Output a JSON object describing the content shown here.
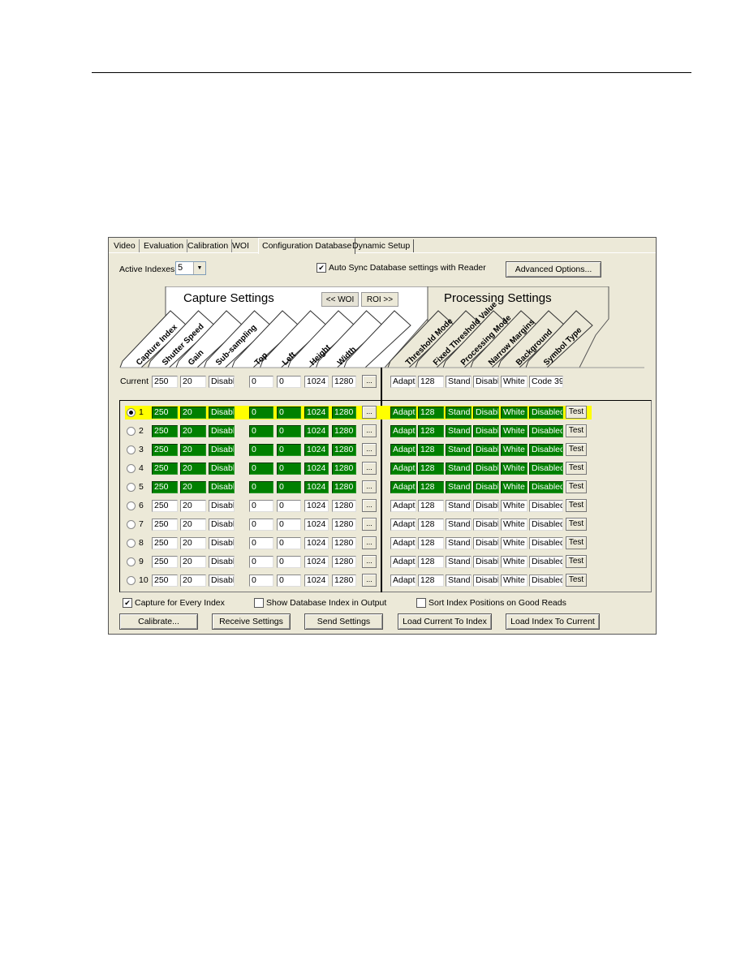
{
  "tabs": [
    {
      "label": "Video",
      "active": false
    },
    {
      "label": "Evaluation",
      "active": false
    },
    {
      "label": "Calibration",
      "active": false
    },
    {
      "label": "WOI",
      "active": false
    },
    {
      "label": "Configuration Database",
      "active": true
    },
    {
      "label": "Dynamic Setup",
      "active": false
    }
  ],
  "active_indexes": {
    "label": "Active Indexes",
    "value": "5"
  },
  "auto_sync": {
    "label": "Auto Sync Database settings with Reader",
    "checked": true
  },
  "advanced_options_label": "Advanced Options...",
  "capture_settings": {
    "title": "Capture Settings",
    "woi_button": "<< WOI",
    "roi_button": "ROI >>",
    "columns": [
      "Capture Index",
      "Shutter Speed",
      "Gain",
      "Sub-sampling",
      "Top",
      "Left",
      "Height",
      "Width"
    ]
  },
  "processing_settings": {
    "title": "Processing Settings",
    "columns": [
      "Threshold Mode",
      "Fixed Threshold Value",
      "Processing Mode",
      "Narrow Margins",
      "Background",
      "Symbol Type"
    ]
  },
  "current": {
    "label": "Current",
    "capture": [
      "250",
      "20",
      "Disabl",
      "0",
      "0",
      "1024",
      "1280"
    ],
    "processing": [
      "Adapti",
      "128",
      "Stand",
      "Disabl",
      "White",
      "Code 39"
    ]
  },
  "ellipsis_label": "...",
  "test_label": "Test",
  "rows": [
    {
      "index": "1",
      "selected": true,
      "active": true,
      "capture": [
        "250",
        "20",
        "Disabl",
        "0",
        "0",
        "1024",
        "1280"
      ],
      "processing": [
        "Adapti",
        "128",
        "Stand",
        "Disabl",
        "White",
        "Disabled"
      ]
    },
    {
      "index": "2",
      "selected": false,
      "active": true,
      "capture": [
        "250",
        "20",
        "Disabl",
        "0",
        "0",
        "1024",
        "1280"
      ],
      "processing": [
        "Adapti",
        "128",
        "Stand",
        "Disabl",
        "White",
        "Disabled"
      ]
    },
    {
      "index": "3",
      "selected": false,
      "active": true,
      "capture": [
        "250",
        "20",
        "Disabl",
        "0",
        "0",
        "1024",
        "1280"
      ],
      "processing": [
        "Adapti",
        "128",
        "Stand",
        "Disabl",
        "White",
        "Disabled"
      ]
    },
    {
      "index": "4",
      "selected": false,
      "active": true,
      "capture": [
        "250",
        "20",
        "Disabl",
        "0",
        "0",
        "1024",
        "1280"
      ],
      "processing": [
        "Adapti",
        "128",
        "Stand",
        "Disabl",
        "White",
        "Disabled"
      ]
    },
    {
      "index": "5",
      "selected": false,
      "active": true,
      "capture": [
        "250",
        "20",
        "Disabl",
        "0",
        "0",
        "1024",
        "1280"
      ],
      "processing": [
        "Adapti",
        "128",
        "Stand",
        "Disabl",
        "White",
        "Disabled"
      ]
    },
    {
      "index": "6",
      "selected": false,
      "active": false,
      "capture": [
        "250",
        "20",
        "Disabl",
        "0",
        "0",
        "1024",
        "1280"
      ],
      "processing": [
        "Adapti",
        "128",
        "Stand",
        "Disabl",
        "White",
        "Disabled"
      ]
    },
    {
      "index": "7",
      "selected": false,
      "active": false,
      "capture": [
        "250",
        "20",
        "Disabl",
        "0",
        "0",
        "1024",
        "1280"
      ],
      "processing": [
        "Adapti",
        "128",
        "Stand",
        "Disabl",
        "White",
        "Disabled"
      ]
    },
    {
      "index": "8",
      "selected": false,
      "active": false,
      "capture": [
        "250",
        "20",
        "Disabl",
        "0",
        "0",
        "1024",
        "1280"
      ],
      "processing": [
        "Adapti",
        "128",
        "Stand",
        "Disabl",
        "White",
        "Disabled"
      ]
    },
    {
      "index": "9",
      "selected": false,
      "active": false,
      "capture": [
        "250",
        "20",
        "Disabl",
        "0",
        "0",
        "1024",
        "1280"
      ],
      "processing": [
        "Adapti",
        "128",
        "Stand",
        "Disabl",
        "White",
        "Disabled"
      ]
    },
    {
      "index": "10",
      "selected": false,
      "active": false,
      "capture": [
        "250",
        "20",
        "Disabl",
        "0",
        "0",
        "1024",
        "1280"
      ],
      "processing": [
        "Adapti",
        "128",
        "Stand",
        "Disabl",
        "White",
        "Disabled"
      ]
    }
  ],
  "options": {
    "capture_every_index": {
      "label": "Capture for Every Index",
      "checked": true
    },
    "show_db_index": {
      "label": "Show Database Index in Output",
      "checked": false
    },
    "sort_index": {
      "label": "Sort Index Positions on Good Reads",
      "checked": false
    }
  },
  "buttons": {
    "calibrate": "Calibrate...",
    "receive": "Receive Settings",
    "send": "Send Settings",
    "load_current_to_index": "Load Current To Index",
    "load_index_to_current": "Load Index To Current"
  },
  "colors": {
    "active_row": "#008000",
    "selected_highlight": "#ffff00",
    "dialog_bg": "#ece9d8"
  }
}
